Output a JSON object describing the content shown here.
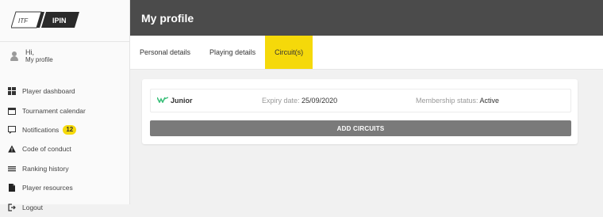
{
  "brand": {
    "logo_left": "ITF",
    "logo_right": "IPIN"
  },
  "user": {
    "greeting": "Hi,",
    "profile_link": "My profile"
  },
  "sidebar": {
    "items": [
      {
        "label": "Player dashboard",
        "icon": "dashboard-icon"
      },
      {
        "label": "Tournament calendar",
        "icon": "calendar-icon"
      },
      {
        "label": "Notifications",
        "icon": "notification-icon",
        "badge": "12"
      },
      {
        "label": "Code of conduct",
        "icon": "warning-icon"
      },
      {
        "label": "Ranking history",
        "icon": "list-icon"
      },
      {
        "label": "Player resources",
        "icon": "document-icon"
      },
      {
        "label": "Logout",
        "icon": "logout-icon"
      }
    ]
  },
  "header": {
    "title": "My profile"
  },
  "tabs": [
    {
      "label": "Personal details",
      "active": false
    },
    {
      "label": "Playing details",
      "active": false
    },
    {
      "label": "Circuit(s)",
      "active": true
    }
  ],
  "circuit": {
    "name": "Junior",
    "expiry_label": "Expiry date:",
    "expiry_value": "25/09/2020",
    "membership_label": "Membership status:",
    "membership_value": "Active"
  },
  "add_button": "ADD CIRCUITS",
  "colors": {
    "accent": "#f5d90a",
    "topbar": "#4b4b4b",
    "button": "#7a7a7a",
    "junior": "#3bbf7a"
  }
}
